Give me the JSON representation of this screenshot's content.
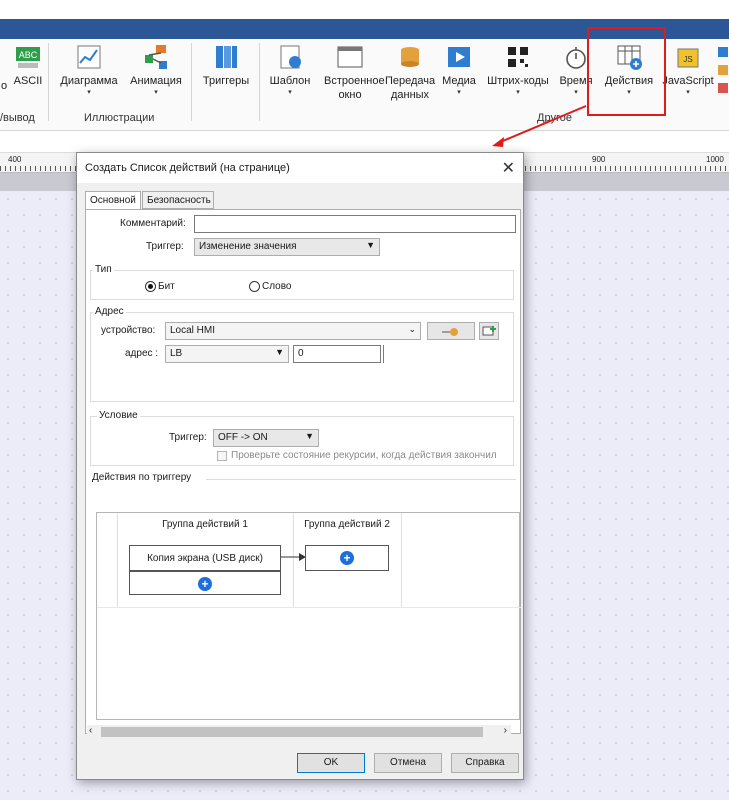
{
  "ribbon": {
    "items": [
      {
        "label": "ASCII",
        "sub": ""
      },
      {
        "label": "Диаграмма",
        "sub": "▾"
      },
      {
        "label": "Анимация",
        "sub": "▾"
      },
      {
        "label": "Триггеры",
        "sub": ""
      },
      {
        "label": "Шаблон",
        "sub": "▾"
      },
      {
        "label": "Встроенное окно",
        "sub": ""
      },
      {
        "label": "Передача данных",
        "sub": "▾"
      },
      {
        "label": "Медиа",
        "sub": "▾"
      },
      {
        "label": "Штрих-коды",
        "sub": "▾"
      },
      {
        "label": "Время",
        "sub": "▾"
      },
      {
        "label": "Действия",
        "sub": "▾"
      },
      {
        "label": "JavaScript",
        "sub": "▾"
      }
    ],
    "group_labels": {
      "io": "/вывод",
      "illustrations": "Иллюстрации",
      "other": "Другое"
    },
    "left_label": "о",
    "ascii_icon_text": "ABC",
    "js_icon_text": "JS"
  },
  "ruler": {
    "marks": [
      "400",
      "900",
      "1000"
    ]
  },
  "dialog": {
    "title": "Создать Список действий (на странице)",
    "tabs": [
      "Основной",
      "Безопасность"
    ],
    "comment_label": "Комментарий:",
    "comment_value": "",
    "trigger_label": "Триггер:",
    "trigger_value": "Изменение значения",
    "type_legend": "Тип",
    "type_bit": "Бит",
    "type_word": "Слово",
    "address_legend": "Адрес",
    "device_label": "устройство:",
    "device_value": "Local HMI",
    "addr_label": "адрес :",
    "addr_type": "LB",
    "addr_value": "0",
    "condition_legend": "Условие",
    "cond_trigger_label": "Триггер:",
    "cond_trigger_value": "OFF -> ON",
    "recursion_check_label": "Проверьте состояние рекурсии, когда действия закончил",
    "actions_legend": "Действия по триггеру",
    "group1": "Группа действий 1",
    "group2": "Группа действий 2",
    "action1": "Копия экрана (USB диск)",
    "ok": "OK",
    "cancel": "Отмена",
    "help": "Справка"
  },
  "colors": {
    "accent": "#2b5797",
    "highlight": "#e01b1b",
    "plus": "#1e6fd9"
  }
}
